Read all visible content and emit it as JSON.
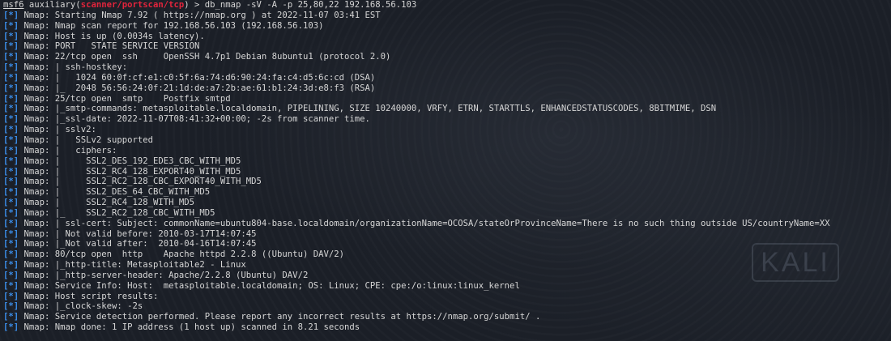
{
  "watermark": "KALI",
  "prompt": {
    "shell": "msf6",
    "module_prefix": " auxiliary(",
    "module": "scanner/portscan/tcp",
    "module_suffix": ") > ",
    "command": "db_nmap -sV -A -p 25,80,22 192.168.56.103"
  },
  "tag": "[*]",
  "lines": [
    "Nmap: Starting Nmap 7.92 ( https://nmap.org ) at 2022-11-07 03:41 EST",
    "Nmap: Nmap scan report for 192.168.56.103 (192.168.56.103)",
    "Nmap: Host is up (0.0034s latency).",
    "Nmap: PORT   STATE SERVICE VERSION",
    "Nmap: 22/tcp open  ssh     OpenSSH 4.7p1 Debian 8ubuntu1 (protocol 2.0)",
    "Nmap: | ssh-hostkey:",
    "Nmap: |   1024 60:0f:cf:e1:c0:5f:6a:74:d6:90:24:fa:c4:d5:6c:cd (DSA)",
    "Nmap: |_  2048 56:56:24:0f:21:1d:de:a7:2b:ae:61:b1:24:3d:e8:f3 (RSA)",
    "Nmap: 25/tcp open  smtp    Postfix smtpd",
    "Nmap: |_smtp-commands: metasploitable.localdomain, PIPELINING, SIZE 10240000, VRFY, ETRN, STARTTLS, ENHANCEDSTATUSCODES, 8BITMIME, DSN",
    "Nmap: |_ssl-date: 2022-11-07T08:41:32+00:00; -2s from scanner time.",
    "Nmap: | sslv2:",
    "Nmap: |   SSLv2 supported",
    "Nmap: |   ciphers:",
    "Nmap: |     SSL2_DES_192_EDE3_CBC_WITH_MD5",
    "Nmap: |     SSL2_RC4_128_EXPORT40_WITH_MD5",
    "Nmap: |     SSL2_RC2_128_CBC_EXPORT40_WITH_MD5",
    "Nmap: |     SSL2_DES_64_CBC_WITH_MD5",
    "Nmap: |     SSL2_RC4_128_WITH_MD5",
    "Nmap: |_    SSL2_RC2_128_CBC_WITH_MD5",
    "Nmap: | ssl-cert: Subject: commonName=ubuntu804-base.localdomain/organizationName=OCOSA/stateOrProvinceName=There is no such thing outside US/countryName=XX",
    "Nmap: | Not valid before: 2010-03-17T14:07:45",
    "Nmap: |_Not valid after:  2010-04-16T14:07:45",
    "Nmap: 80/tcp open  http    Apache httpd 2.2.8 ((Ubuntu) DAV/2)",
    "Nmap: |_http-title: Metasploitable2 - Linux",
    "Nmap: |_http-server-header: Apache/2.2.8 (Ubuntu) DAV/2",
    "Nmap: Service Info: Host:  metasploitable.localdomain; OS: Linux; CPE: cpe:/o:linux:linux_kernel",
    "Nmap: Host script results:",
    "Nmap: |_clock-skew: -2s",
    "Nmap: Service detection performed. Please report any incorrect results at https://nmap.org/submit/ .",
    "Nmap: Nmap done: 1 IP address (1 host up) scanned in 8.21 seconds"
  ],
  "colors": {
    "background": "#1b1f27",
    "text": "#d6d6d6",
    "info_tag": "#3b8eea",
    "module": "#e2243c"
  }
}
